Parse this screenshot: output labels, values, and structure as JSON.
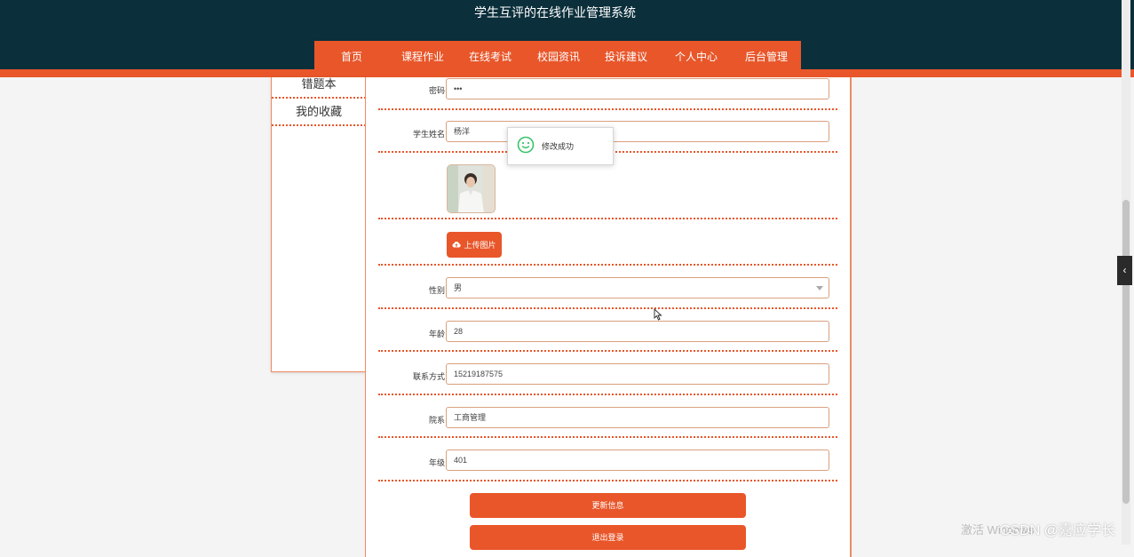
{
  "header": {
    "site_title": "学生互评的在线作业管理系统",
    "nav": [
      "首页",
      "课程作业",
      "在线考试",
      "校园资讯",
      "投诉建议",
      "个人中心",
      "后台管理"
    ]
  },
  "sidebar": {
    "items": [
      "错题本",
      "我的收藏"
    ]
  },
  "form": {
    "password_label": "密码",
    "password_value": "•••",
    "name_label": "学生姓名",
    "name_value": "杨洋",
    "upload_label": "上传图片",
    "gender_label": "性别",
    "gender_value": "男",
    "age_label": "年龄",
    "age_value": "28",
    "contact_label": "联系方式",
    "contact_value": "15219187575",
    "dept_label": "院系",
    "dept_value": "工商管理",
    "grade_label": "年级",
    "grade_value": "401",
    "update_button": "更新信息",
    "logout_button": "退出登录"
  },
  "toast": {
    "message": "修改成功"
  },
  "overlay": {
    "activate_text": "激活 Windows",
    "credit": "CSDN @嘉应学长"
  },
  "colors": {
    "accent": "#e8562a",
    "header_bg": "#0b2f3b"
  }
}
